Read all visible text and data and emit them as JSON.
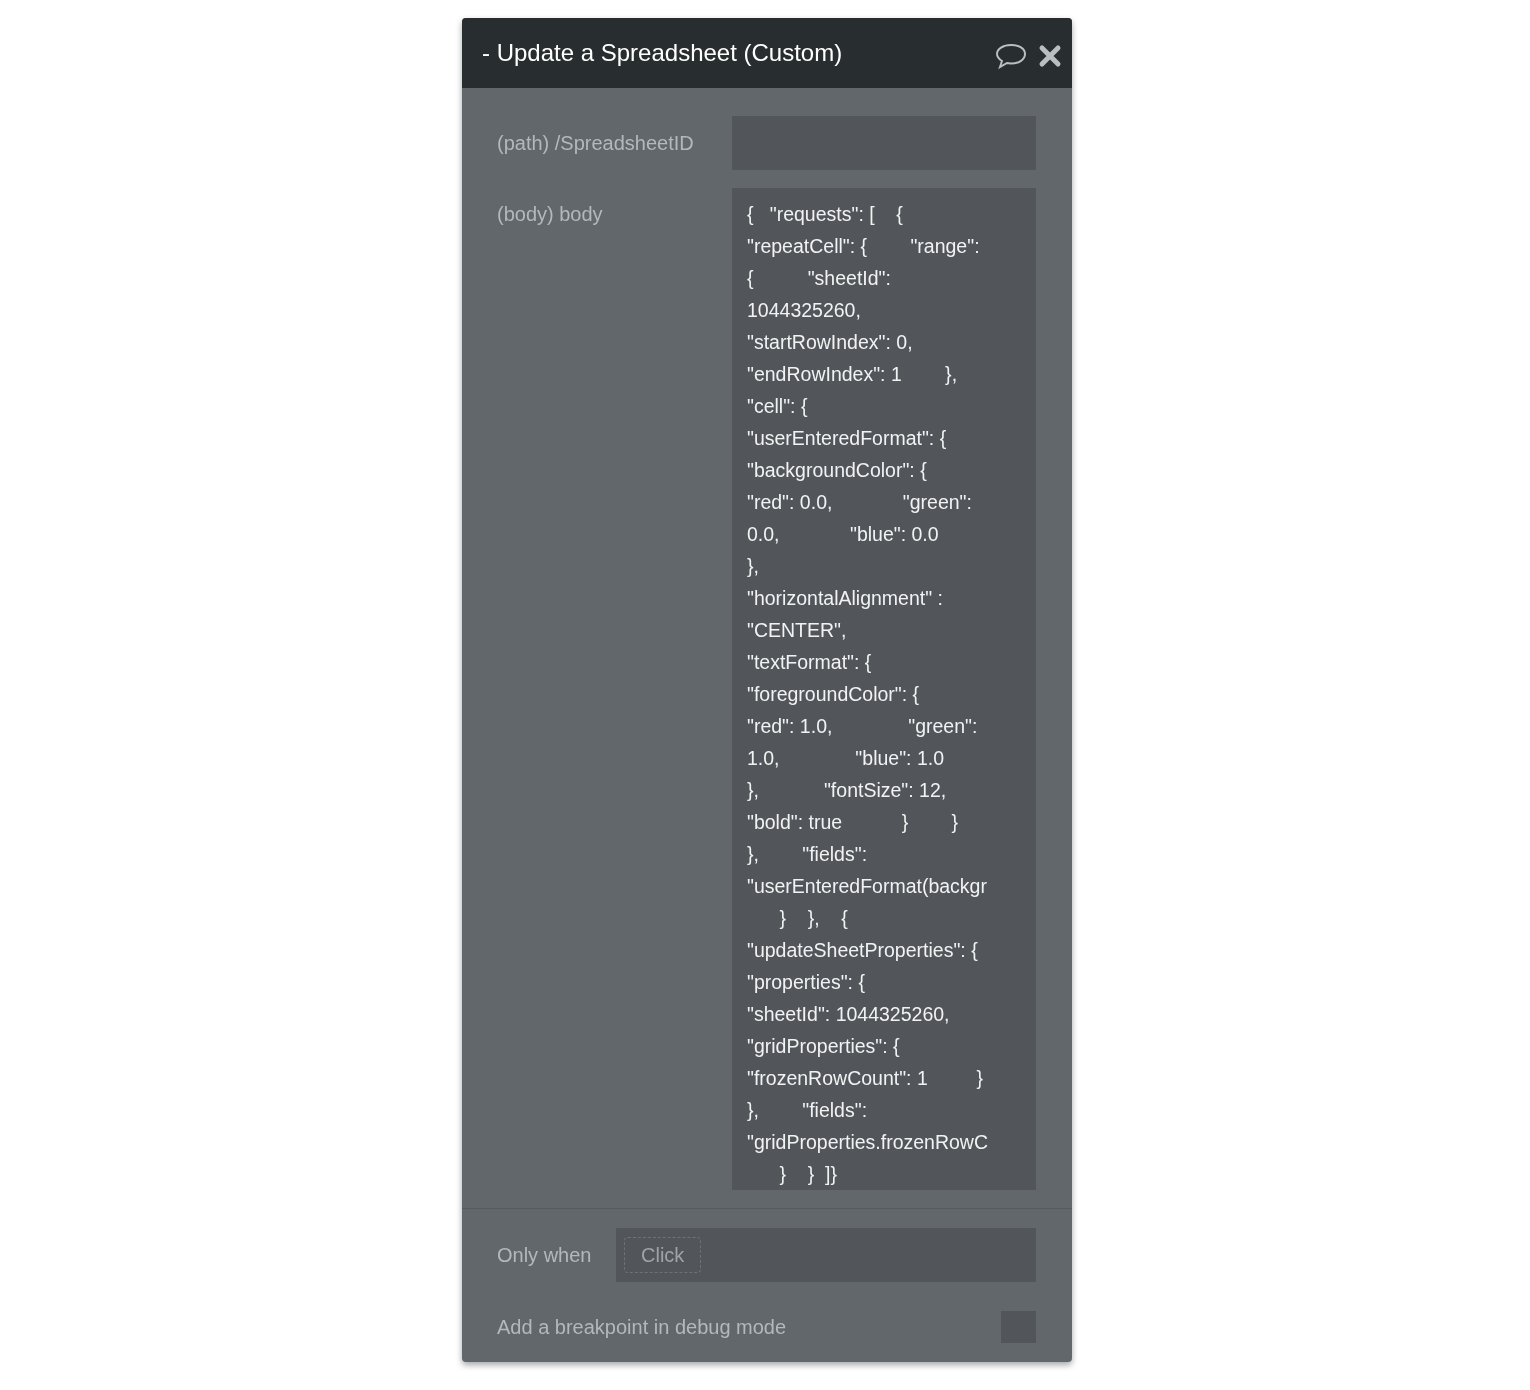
{
  "dialog": {
    "title": "- Update a Spreadsheet (Custom)",
    "path_param": {
      "label": "(path) /SpreadsheetID"
    },
    "body_param": {
      "label": "(body) body",
      "lines": [
        "{   \"requests\": [    {",
        "\"repeatCell\": {        \"range\":",
        "{          \"sheetId\":",
        "1044325260,",
        "\"startRowIndex\": 0,",
        "\"endRowIndex\": 1        },",
        "\"cell\": {",
        "\"userEnteredFormat\": {",
        "\"backgroundColor\": {",
        "\"red\": 0.0,             \"green\":",
        "0.0,             \"blue\": 0.0",
        "},",
        "\"horizontalAlignment\" :",
        "\"CENTER\",",
        "\"textFormat\": {",
        "\"foregroundColor\": {",
        "\"red\": 1.0,              \"green\":",
        "1.0,              \"blue\": 1.0",
        "},            \"fontSize\": 12,",
        "\"bold\": true           }        }",
        "},        \"fields\":",
        "\"userEnteredFormat(backgr",
        "      }    },    {",
        "\"updateSheetProperties\": {",
        "\"properties\": {",
        "\"sheetId\": 1044325260,",
        "\"gridProperties\": {",
        "\"frozenRowCount\": 1         }",
        "},        \"fields\":",
        "\"gridProperties.frozenRowC",
        "      }    }  ]}"
      ]
    },
    "condition": {
      "label": "Only when",
      "placeholder": "Click"
    },
    "breakpoint": {
      "label": "Add a breakpoint in debug mode",
      "checked": false
    }
  }
}
